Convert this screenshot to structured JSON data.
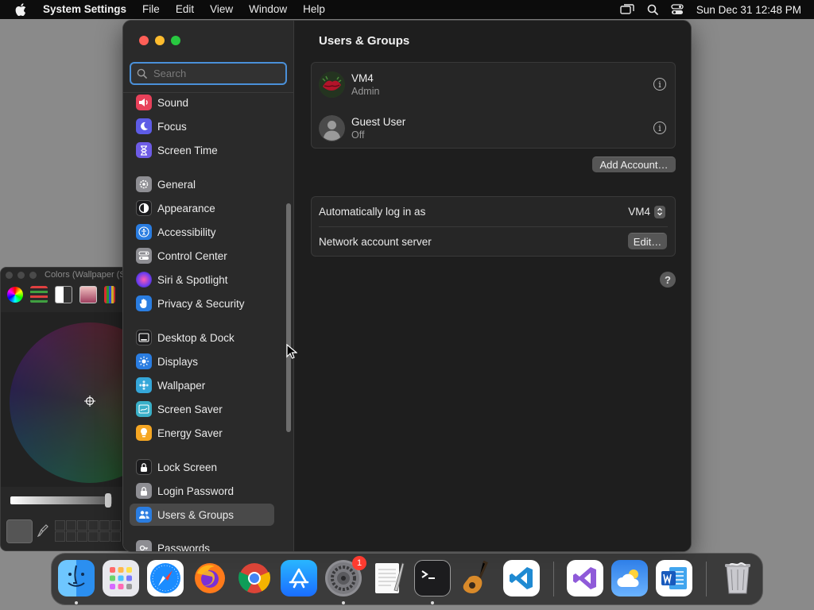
{
  "menubar": {
    "app_name": "System Settings",
    "menus": [
      "File",
      "Edit",
      "View",
      "Window",
      "Help"
    ],
    "clock": "Sun Dec 31  12:48 PM"
  },
  "colors_window": {
    "title": "Colors (Wallpaper (S"
  },
  "sidebar": {
    "search_placeholder": "Search",
    "items": [
      {
        "label": "Sound",
        "icon": "speaker-icon",
        "color": "#e8415a"
      },
      {
        "label": "Focus",
        "icon": "moon-icon",
        "color": "#5e5ce6"
      },
      {
        "label": "Screen Time",
        "icon": "hourglass-icon",
        "color": "#6e5ce6"
      },
      {
        "label": "General",
        "icon": "gear-icon",
        "color": "#8e8e93"
      },
      {
        "label": "Appearance",
        "icon": "appearance-icon",
        "color": "#1c1c1e"
      },
      {
        "label": "Accessibility",
        "icon": "accessibility-icon",
        "color": "#2a7de1"
      },
      {
        "label": "Control Center",
        "icon": "control-center-icon",
        "color": "#8e8e93"
      },
      {
        "label": "Siri & Spotlight",
        "icon": "siri-icon",
        "color": "#b14be0"
      },
      {
        "label": "Privacy & Security",
        "icon": "hand-icon",
        "color": "#2a7de1"
      },
      {
        "label": "Desktop & Dock",
        "icon": "dock-icon",
        "color": "#1c1c1e"
      },
      {
        "label": "Displays",
        "icon": "sun-icon",
        "color": "#2a7de1"
      },
      {
        "label": "Wallpaper",
        "icon": "wallpaper-icon",
        "color": "#35a7d9"
      },
      {
        "label": "Screen Saver",
        "icon": "screen-saver-icon",
        "color": "#3ab0c8"
      },
      {
        "label": "Energy Saver",
        "icon": "bulb-icon",
        "color": "#f5a623"
      },
      {
        "label": "Lock Screen",
        "icon": "lock-icon",
        "color": "#1c1c1e"
      },
      {
        "label": "Login Password",
        "icon": "key-lock-icon",
        "color": "#8e8e93"
      },
      {
        "label": "Users & Groups",
        "icon": "users-icon",
        "color": "#2a7de1"
      },
      {
        "label": "Passwords",
        "icon": "passwords-icon",
        "color": "#8e8e93"
      }
    ],
    "selected_label": "Users & Groups"
  },
  "main": {
    "title": "Users & Groups",
    "users": [
      {
        "name": "VM4",
        "role": "Admin"
      },
      {
        "name": "Guest User",
        "role": "Off"
      }
    ],
    "add_account_label": "Add Account…",
    "auto_login_label": "Automatically log in as",
    "auto_login_value": "VM4",
    "network_server_label": "Network account server",
    "edit_label": "Edit…",
    "help_label": "?"
  },
  "dock": {
    "apps": [
      "Finder",
      "Launchpad",
      "Safari",
      "Firefox",
      "Chrome",
      "App Store",
      "System Settings",
      "TextEdit",
      "Terminal",
      "GarageBand",
      "Visual Studio Code",
      "Visual Studio",
      "Weather",
      "Microsoft Word",
      "Trash"
    ],
    "system_settings_badge": "1"
  },
  "colors": {
    "accent": "#4a90d9",
    "close": "#ff5f57",
    "minimize": "#febc2e",
    "zoom": "#28c840"
  }
}
